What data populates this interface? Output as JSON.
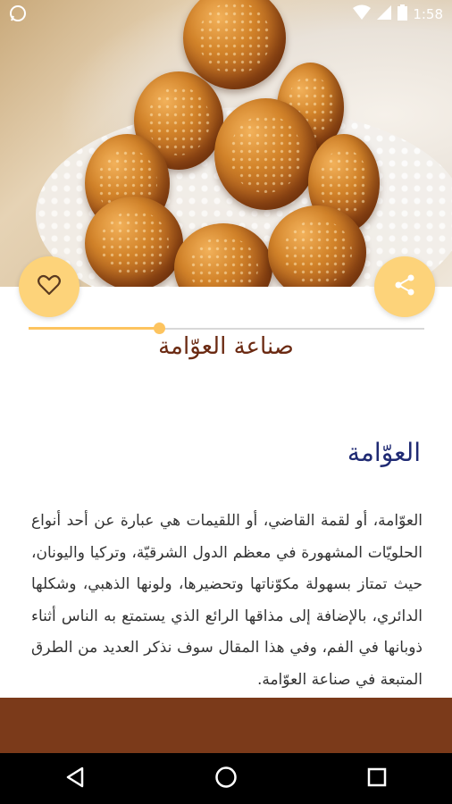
{
  "status_bar": {
    "time": "1:58",
    "icons": [
      "whatsapp-icon",
      "wifi-icon",
      "signal-icon",
      "battery-icon"
    ]
  },
  "hero": {
    "image_subject": "luqaimat"
  },
  "actions": {
    "like_icon": "heart-icon",
    "share_icon": "share-icon"
  },
  "progress": {
    "fraction": 0.33
  },
  "article": {
    "title": "صناعة العوّامة",
    "heading": "العوّامة",
    "body": "العوّامة، أو لقمة القاضي، أو اللقيمات هي عبارة عن أحد أنواع الحلويّات المشهورة في معظم الدول الشرقيّة، وتركيا واليونان، حيث تمتاز بسهولة مكوّناتها وتحضيرها، ولونها الذهبي، وشكلها الدائري، بالإضافة إلى مذاقها الرائع الذي يستمتع به الناس أثناء ذوبانها في الفم، وفي هذا المقال سوف نذكر العديد من الطرق المتبعة في صناعة العوّامة."
  },
  "navbar": {
    "back_icon": "back-triangle-icon",
    "home_icon": "home-circle-icon",
    "recents_icon": "recents-square-icon"
  },
  "colors": {
    "accent": "#fdd37a",
    "title": "#6b2a12",
    "heading": "#1f2a73",
    "footer": "#7b3a1a"
  }
}
